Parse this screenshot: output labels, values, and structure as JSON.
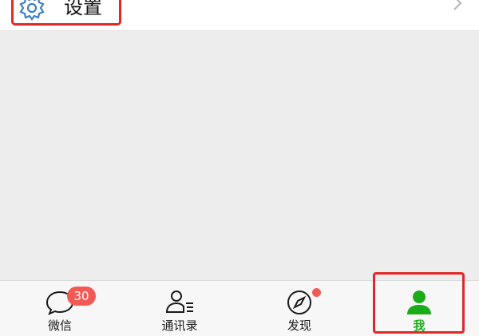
{
  "settings": {
    "label": "设置",
    "icon": "gear-icon",
    "chevron": "chevron-right-icon"
  },
  "tabbar": {
    "tabs": [
      {
        "key": "chats",
        "label": "微信",
        "icon": "chat-bubble-icon",
        "badge": "30"
      },
      {
        "key": "contacts",
        "label": "通讯录",
        "icon": "contacts-icon"
      },
      {
        "key": "discover",
        "label": "发现",
        "icon": "compass-icon",
        "dot": true
      },
      {
        "key": "me",
        "label": "我",
        "icon": "person-icon",
        "active": true
      }
    ]
  },
  "colors": {
    "accent": "#1aad19",
    "badge": "#f25a55",
    "highlight": "#e32727",
    "icon_blue": "#3d7fc4",
    "background": "#ededed"
  }
}
